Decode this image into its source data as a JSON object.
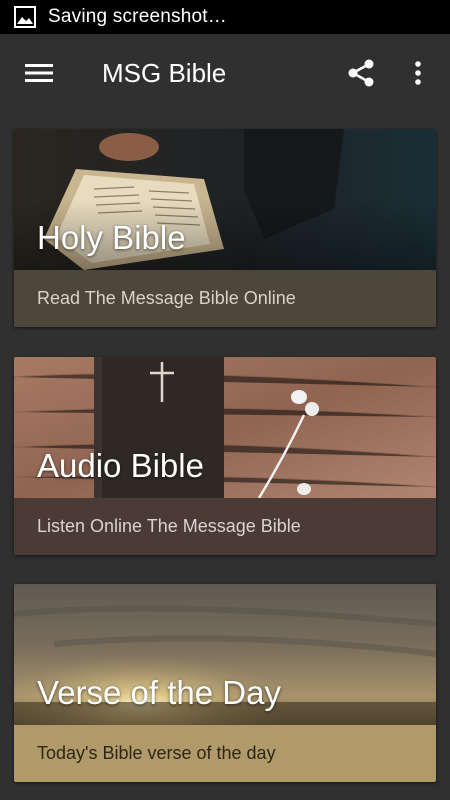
{
  "status_bar": {
    "text": "Saving screenshot…",
    "icon": "image-icon"
  },
  "app_bar": {
    "title": "MSG Bible",
    "menu_icon": "hamburger-menu-icon",
    "share_icon": "share-icon",
    "more_icon": "more-vertical-icon"
  },
  "cards": [
    {
      "title": "Holy Bible",
      "subtitle": "Read The Message Bible Online",
      "footer_color": "#4d463a"
    },
    {
      "title": "Audio Bible",
      "subtitle": "Listen Online The Message Bible",
      "footer_color": "#4a3b37"
    },
    {
      "title": "Verse of the Day",
      "subtitle": "Today's Bible verse of the day",
      "footer_color": "#b09a6a"
    }
  ],
  "colors": {
    "background": "#303030",
    "status_bar": "#000000"
  }
}
